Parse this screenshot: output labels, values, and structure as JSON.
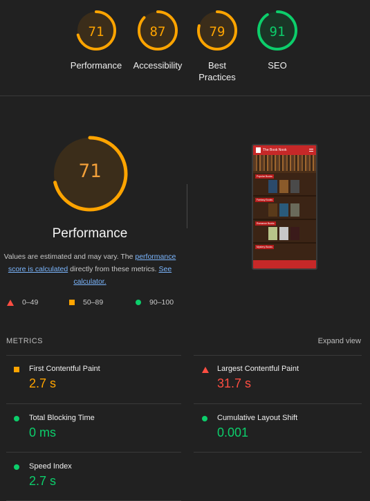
{
  "summary_gauges": [
    {
      "label": "Performance",
      "score": "71",
      "color": "#ffa400",
      "fraction": 0.71
    },
    {
      "label": "Accessibility",
      "score": "87",
      "color": "#ffa400",
      "fraction": 0.87
    },
    {
      "label_line1": "Best",
      "label_line2": "Practices",
      "score": "79",
      "color": "#ffa400",
      "fraction": 0.79
    },
    {
      "label": "SEO",
      "score": "91",
      "color": "#0cce6b",
      "fraction": 0.91
    }
  ],
  "performance": {
    "score": "71",
    "fraction": 0.71,
    "title": "Performance",
    "desc_part1": "Values are estimated and may vary. The ",
    "desc_link1": "performance score is calculated",
    "desc_part2": " directly from these metrics. ",
    "desc_link2": "See calculator."
  },
  "legend": [
    {
      "icon": "triangle-icon",
      "range": "0–49"
    },
    {
      "icon": "square-icon",
      "range": "50–89"
    },
    {
      "icon": "circle-icon",
      "range": "90–100"
    }
  ],
  "preview": {
    "site_title": "The Book Nook",
    "sections": [
      "Popular Books",
      "Fantasy Books",
      "Romance Books",
      "Mystery Books"
    ]
  },
  "metrics": {
    "header": "METRICS",
    "expand": "Expand view",
    "items": [
      {
        "name": "First Contentful Paint",
        "value": "2.7 s",
        "status": "average",
        "icon": "square-icon"
      },
      {
        "name": "Largest Contentful Paint",
        "value": "31.7 s",
        "status": "fail",
        "icon": "triangle-icon"
      },
      {
        "name": "Total Blocking Time",
        "value": "0 ms",
        "status": "pass",
        "icon": "circle-icon"
      },
      {
        "name": "Cumulative Layout Shift",
        "value": "0.001",
        "status": "pass",
        "icon": "circle-icon"
      },
      {
        "name": "Speed Index",
        "value": "2.7 s",
        "status": "pass",
        "icon": "circle-icon"
      }
    ]
  },
  "colors": {
    "fail": "#ff4e42",
    "average": "#ffa400",
    "pass": "#0cce6b"
  }
}
